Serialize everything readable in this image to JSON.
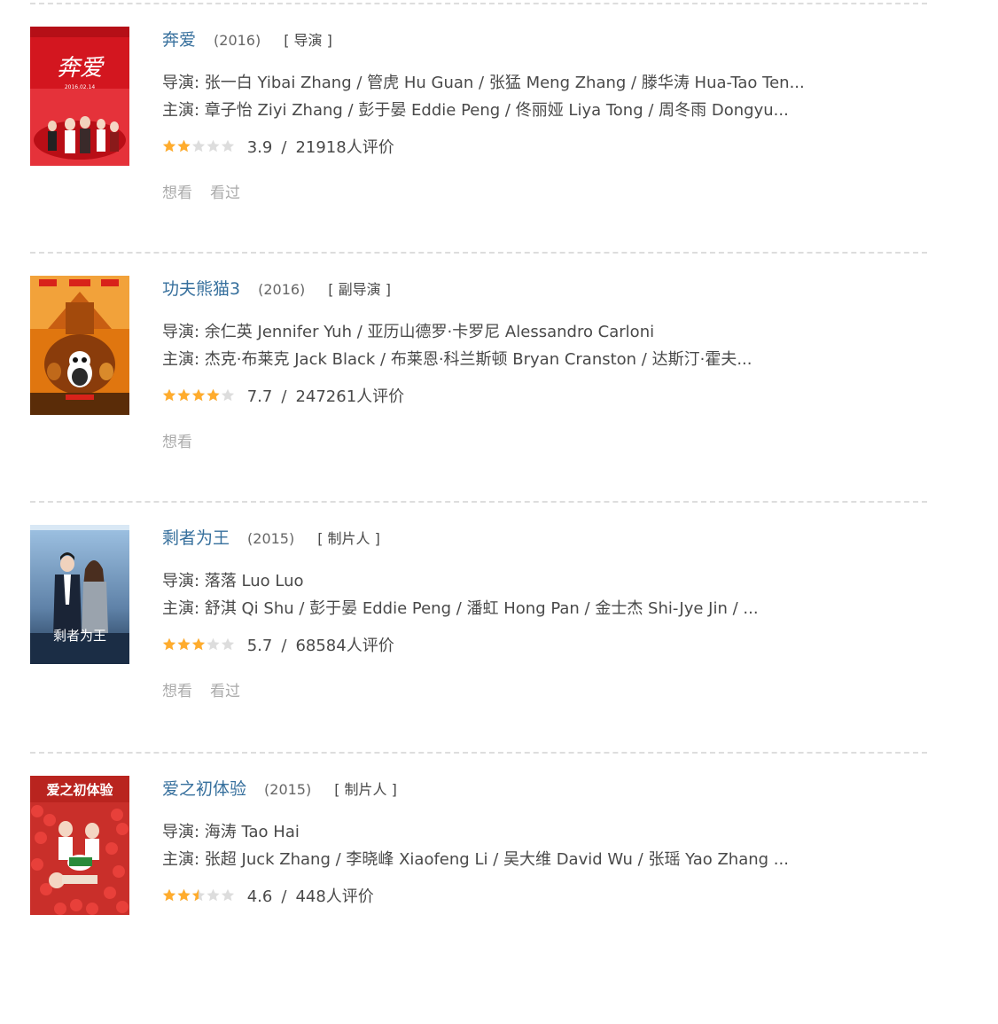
{
  "movies": [
    {
      "title": "奔爱",
      "year": "(2016)",
      "role": "[ 导演 ]",
      "directors": "导演: 张一白 Yibai Zhang / 管虎 Hu Guan / 张猛 Meng Zhang / 滕华涛 Hua-Tao Ten...",
      "cast": "主演: 章子怡 Ziyi Zhang / 彭于晏 Eddie Peng / 佟丽娅 Liya Tong / 周冬雨 Dongyu...",
      "stars": 2,
      "score": "3.9",
      "separator": "/",
      "votes": "21918人评价",
      "actions": [
        "想看",
        "看过"
      ],
      "poster_text": "奔爱",
      "poster_subtext": "2016.02.14",
      "poster_colors": {
        "bg": "#d3161f",
        "accent": "#ffffff"
      }
    },
    {
      "title": "功夫熊猫3",
      "year": "(2016)",
      "role": "[ 副导演 ]",
      "directors": "导演: 余仁英 Jennifer Yuh / 亚历山德罗·卡罗尼 Alessandro Carloni",
      "cast": "主演: 杰克·布莱克 Jack Black / 布莱恩·科兰斯顿 Bryan Cranston / 达斯汀·霍夫...",
      "stars": 4,
      "score": "7.7",
      "separator": "/",
      "votes": "247261人评价",
      "actions": [
        "想看"
      ],
      "poster_text": "",
      "poster_subtext": "",
      "poster_colors": {
        "bg": "#e0760f",
        "accent": "#3b2208"
      }
    },
    {
      "title": "剩者为王",
      "year": "(2015)",
      "role": "[ 制片人 ]",
      "directors": "导演: 落落 Luo Luo",
      "cast": "主演: 舒淇 Qi Shu / 彭于晏 Eddie Peng / 潘虹 Hong Pan / 金士杰 Shi-Jye Jin / ...",
      "stars": 3,
      "score": "5.7",
      "separator": "/",
      "votes": "68584人评价",
      "actions": [
        "想看",
        "看过"
      ],
      "poster_text": "剩者为王",
      "poster_subtext": "",
      "poster_colors": {
        "bg": "#5f82a8",
        "accent": "#12243c"
      }
    },
    {
      "title": "爱之初体验",
      "year": "(2015)",
      "role": "[ 制片人 ]",
      "directors": "导演: 海涛 Tao Hai",
      "cast": "主演: 张超 Juck Zhang / 李晓峰 Xiaofeng Li / 吴大维 David Wu / 张瑶 Yao Zhang ...",
      "stars": 2.5,
      "score": "4.6",
      "separator": "/",
      "votes": "448人评价",
      "actions": [],
      "poster_text": "爱之初体验",
      "poster_subtext": "",
      "poster_colors": {
        "bg": "#c92f2a",
        "accent": "#ffffff"
      }
    }
  ],
  "star_colors": {
    "filled": "#ffac2d",
    "empty": "#dddddd"
  }
}
